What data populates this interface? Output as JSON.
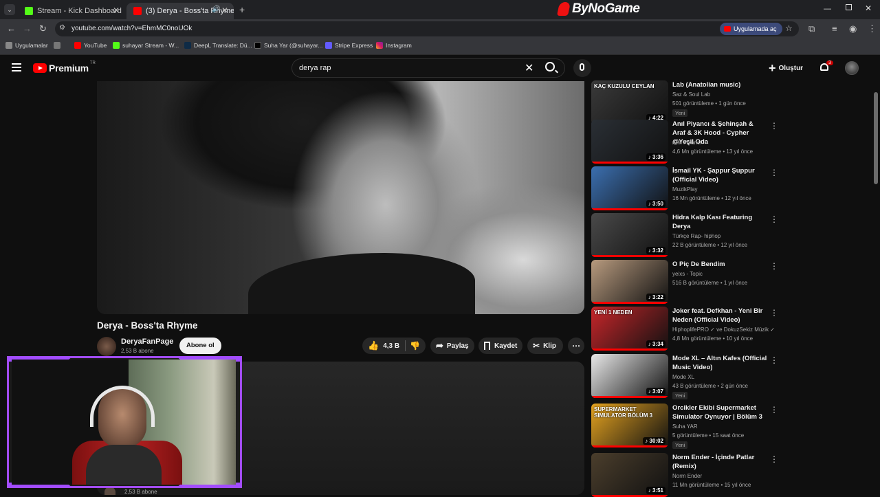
{
  "browser": {
    "tabs": [
      {
        "title": "Stream - Kick Dashboard"
      },
      {
        "title": "(3) Derya - Boss'ta Rhyme"
      }
    ],
    "brand": "ByNoGame",
    "url": "youtube.com/watch?v=EhmMC0noUOk",
    "open_in_app": "Uygulamada aç"
  },
  "bookmarks": [
    "Uygulamalar",
    "YouTube",
    "suhayar Stream - W...",
    "DeepL Translate: Dü...",
    "Suha Yar (@suhayar...",
    "Stripe Express",
    "Instagram"
  ],
  "youtube": {
    "logo": "Premium",
    "logo_region": "TR",
    "search_value": "derya rap",
    "create_label": "Oluştur",
    "notif_count": "3"
  },
  "video": {
    "title": "Derya - Boss'ta Rhyme",
    "channel": "DeryaFanPage",
    "subs": "2,53 B abone",
    "subscribe": "Abone ol",
    "likes": "4,3 B",
    "share": "Paylaş",
    "save": "Kaydet",
    "clip": "Klip",
    "bottom_subs": "2,53 B abone"
  },
  "recommendations": [
    {
      "title": "Lab (Anatolian music)",
      "channel": "Saz & Soul Lab",
      "meta": "501 görüntüleme • 1 gün önce",
      "badge": "Yeni",
      "duration": "4:22",
      "overlay": "KAÇ KUZULU CEYLAN",
      "thumb_color": "#3a3a3a"
    },
    {
      "title": "Anıl Piyancı & Şehinşah & Araf & 3K Hood - Cypher @Yeşil Oda",
      "channel": "Anıl Piyancı",
      "meta": "4,6 Mn görüntüleme • 13 yıl önce",
      "badge": "",
      "duration": "3:36",
      "overlay": "",
      "thumb_color": "#2a2f35"
    },
    {
      "title": "İsmail YK - Şappur Şuppur (Official Video)",
      "channel": "MuzikPlay",
      "meta": "16 Mn görüntüleme • 12 yıl önce",
      "badge": "",
      "duration": "3:50",
      "overlay": "",
      "thumb_color": "#3b6fb0"
    },
    {
      "title": "Hidra  Kalp Kası  Featuring Derya",
      "channel": "Türkçe Rap- hiphop",
      "meta": "22 B görüntüleme • 12 yıl önce",
      "badge": "",
      "duration": "3:32",
      "overlay": "",
      "thumb_color": "#4a4a4a"
    },
    {
      "title": "O Piç De Bendim",
      "channel": "yeixs - Topic",
      "meta": "516 B görüntüleme • 1 yıl önce",
      "badge": "",
      "duration": "3:22",
      "overlay": "",
      "thumb_color": "#b79a7e"
    },
    {
      "title": "Joker feat. Defkhan - Yeni Bir Neden (Official Video)",
      "channel": "HiphoplifePRO ✓ ve DokuzSekiz Müzik ✓",
      "meta": "4,8 Mn görüntüleme • 10 yıl önce",
      "badge": "",
      "duration": "3:34",
      "overlay": "YENİ 1 NEDEN",
      "thumb_color": "#c8262a"
    },
    {
      "title": "Mode XL – Altın Kafes (Official Music Video)",
      "channel": "Mode XL",
      "meta": "43 B görüntüleme • 2 gün önce",
      "badge": "Yeni",
      "duration": "3:07",
      "overlay": "",
      "thumb_color": "#e8e8e8"
    },
    {
      "title": "Orcikler Ekibi Supermarket Simulator Oynuyor | Bölüm 3",
      "channel": "Suha YAR",
      "meta": "5 görüntüleme • 15 saat önce",
      "badge": "Yeni",
      "duration": "30:02",
      "overlay": "SUPERMARKET SIMULATOR BÖLÜM 3",
      "thumb_color": "#e5a320"
    },
    {
      "title": "Norm Ender - İçinde Patlar (Remix)",
      "channel": "Norm Ender",
      "meta": "11 Mn görüntüleme • 15 yıl önce",
      "badge": "",
      "duration": "3:51",
      "overlay": "",
      "thumb_color": "#4b3e2c"
    }
  ]
}
